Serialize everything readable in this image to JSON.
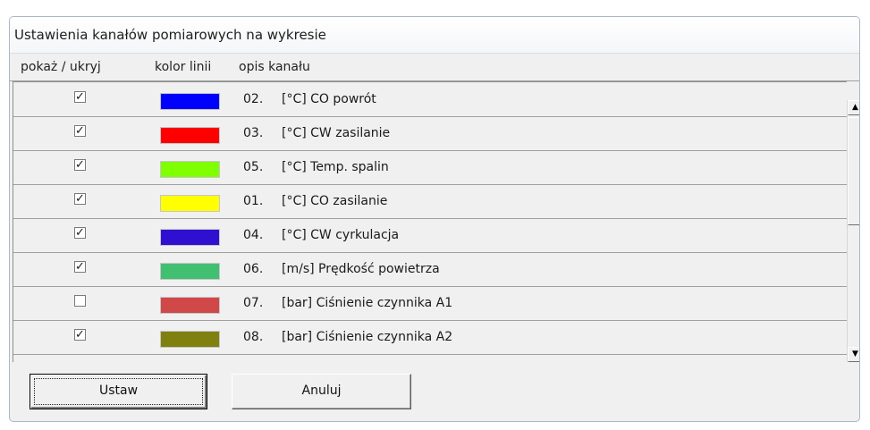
{
  "dialog": {
    "title": "Ustawienia kanałów pomiarowych na wykresie"
  },
  "table": {
    "headers": {
      "show_hide": "pokaż / ukryj",
      "line_color": "kolor linii",
      "channel_desc": "opis kanału"
    },
    "rows": [
      {
        "checked": true,
        "color": "#0000ff",
        "num": "02.",
        "desc": "[°C] CO powrót"
      },
      {
        "checked": true,
        "color": "#ff0000",
        "num": "03.",
        "desc": "[°C] CW zasilanie"
      },
      {
        "checked": true,
        "color": "#80ff00",
        "num": "05.",
        "desc": "[°C] Temp. spalin"
      },
      {
        "checked": true,
        "color": "#ffff00",
        "num": "01.",
        "desc": "[°C] CO zasilanie"
      },
      {
        "checked": true,
        "color": "#3010d0",
        "num": "04.",
        "desc": "[°C] CW cyrkulacja"
      },
      {
        "checked": true,
        "color": "#40c070",
        "num": "06.",
        "desc": "[m/s] Prędkość powietrza"
      },
      {
        "checked": false,
        "color": "#d04848",
        "num": "07.",
        "desc": "[bar] Ciśnienie czynnika A1"
      },
      {
        "checked": true,
        "color": "#808010",
        "num": "08.",
        "desc": "[bar] Ciśnienie czynnika A2"
      }
    ],
    "scroll": {
      "up_arrow": "▲",
      "down_arrow": "▼"
    }
  },
  "buttons": {
    "ok_label": "Ustaw",
    "cancel_label": "Anuluj"
  }
}
